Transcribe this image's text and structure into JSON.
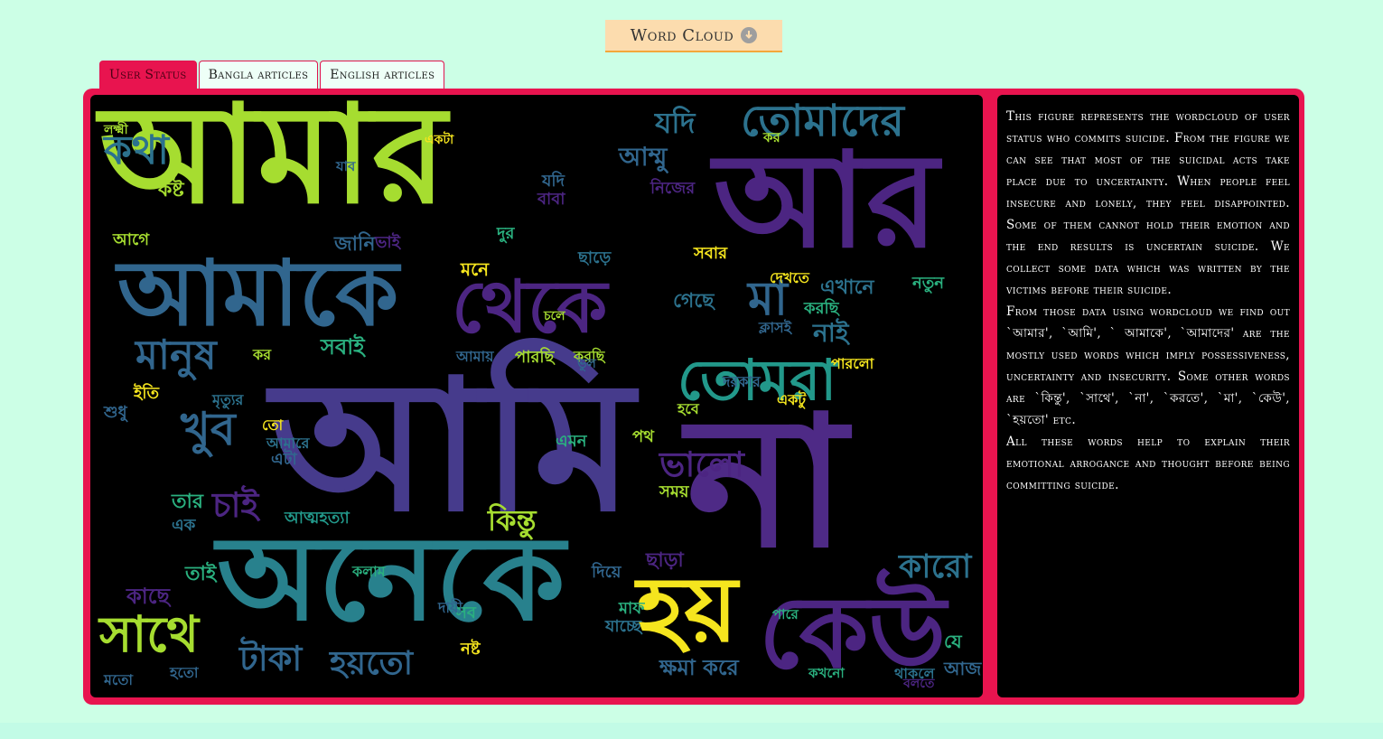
{
  "header_button": {
    "label": "Word Cloud",
    "icon": "download-circle-icon"
  },
  "tabs": [
    {
      "label": "User Status",
      "active": true
    },
    {
      "label": "Bangla articles",
      "active": false
    },
    {
      "label": "English articles",
      "active": false
    }
  ],
  "colors": {
    "page_bg": "#ccffe6",
    "accent": "#e8144f",
    "button_bg": "#fcdcae",
    "cloud_bg": "#000000"
  },
  "description": [
    "This figure represents the wordcloud of user status who commits suicide. From the figure we can see that most of the suicidal acts take place due to uncertainty. When people feel insecure and lonely, they feel disappointed. Some of them cannot hold their emotion and the end results is uncertain suicide. We collect some data which was written by the victims before their suicide.",
    "From those data using wordcloud we find out `আমার', `আমি', ` আমাকে', `আমাদের' are the mostly used words which imply possessiveness, uncertainty and insecurity. Some other words are `কিন্তু', `সাথে', `না', `করতে', `মা', `কেউ', `হয়তো' etc.",
    "All these words help to explain their emotional arrogance and thought before being committing suicide."
  ],
  "wordcloud": [
    {
      "text": "আমার",
      "color": "#a6dd30"
    },
    {
      "text": "আমি",
      "color": "#463b8c"
    },
    {
      "text": "আর",
      "color": "#4c2582"
    },
    {
      "text": "আমাকে",
      "color": "#31668e"
    },
    {
      "text": "অনেকে",
      "color": "#28818d"
    },
    {
      "text": "না",
      "color": "#4e2a86"
    },
    {
      "text": "থেকে",
      "color": "#4c2582"
    },
    {
      "text": "হয়",
      "color": "#f5e51e"
    },
    {
      "text": "কেউ",
      "color": "#4c2582"
    },
    {
      "text": "তোমাদের",
      "color": "#2c728e"
    },
    {
      "text": "তোমরা",
      "color": "#22988a"
    },
    {
      "text": "মানুষ",
      "color": "#31668e"
    },
    {
      "text": "সাথে",
      "color": "#a6dd30"
    },
    {
      "text": "খুব",
      "color": "#31668e"
    },
    {
      "text": "মা",
      "color": "#31668e"
    },
    {
      "text": "ভালো",
      "color": "#4c2582"
    },
    {
      "text": "কিন্তু",
      "color": "#a6dd30"
    },
    {
      "text": "যদি",
      "color": "#2c728e"
    },
    {
      "text": "আম্মু",
      "color": "#31668e"
    },
    {
      "text": "কষ্ট",
      "color": "#a6dd30"
    },
    {
      "text": "সবাই",
      "color": "#2ab07f"
    },
    {
      "text": "টাকা",
      "color": "#31668e"
    },
    {
      "text": "হয়তো",
      "color": "#31668e"
    },
    {
      "text": "চাই",
      "color": "#4c2582"
    },
    {
      "text": "তাই",
      "color": "#2ab07f"
    },
    {
      "text": "ক্ষমা করে",
      "color": "#31668e"
    },
    {
      "text": "এখানে",
      "color": "#2c728e"
    },
    {
      "text": "নাই",
      "color": "#2c728e"
    },
    {
      "text": "আত্মহত্যা",
      "color": "#22988a"
    },
    {
      "text": "জানি",
      "color": "#31668e"
    },
    {
      "text": "ছাড়া",
      "color": "#4c2582"
    },
    {
      "text": "কারো",
      "color": "#2c728e"
    },
    {
      "text": "নিজের",
      "color": "#4c2582"
    },
    {
      "text": "করছি",
      "color": "#2ab07f"
    },
    {
      "text": "কথা",
      "color": "#2c728e"
    },
    {
      "text": "যাব",
      "color": "#31668e"
    },
    {
      "text": "যদি",
      "color": "#31668e"
    },
    {
      "text": "বাবা",
      "color": "#4c2582"
    },
    {
      "text": "লক্ষ্মী",
      "color": "#a6dd30"
    },
    {
      "text": "আগে",
      "color": "#a6dd30"
    },
    {
      "text": "ভাই",
      "color": "#4c2582"
    },
    {
      "text": "মনে",
      "color": "#f5e51e"
    },
    {
      "text": "দুর",
      "color": "#2ab07f"
    },
    {
      "text": "ইতি",
      "color": "#f5e51e"
    },
    {
      "text": "শুধু",
      "color": "#31668e"
    },
    {
      "text": "সময়",
      "color": "#a6dd30"
    },
    {
      "text": "পথ",
      "color": "#a6dd30"
    },
    {
      "text": "এমন",
      "color": "#2ab07f"
    },
    {
      "text": "নতুন",
      "color": "#2ab07f"
    },
    {
      "text": "দিয়ে",
      "color": "#31668e"
    },
    {
      "text": "ছাড়ে",
      "color": "#2c728e"
    },
    {
      "text": "সবার",
      "color": "#f5e51e"
    },
    {
      "text": "গেছে",
      "color": "#2c728e"
    },
    {
      "text": "মাফ",
      "color": "#2ab07f"
    },
    {
      "text": "যাচ্ছে",
      "color": "#2c728e"
    },
    {
      "text": "কাছে",
      "color": "#4c2582"
    },
    {
      "text": "এক",
      "color": "#2c728e"
    },
    {
      "text": "তার",
      "color": "#2ab07f"
    },
    {
      "text": "সব",
      "color": "#2ab07f"
    },
    {
      "text": "নষ্ট",
      "color": "#f5e51e"
    },
    {
      "text": "আজ",
      "color": "#31668e"
    },
    {
      "text": "যে",
      "color": "#2ab07f"
    },
    {
      "text": "থাকলে",
      "color": "#2c728e"
    },
    {
      "text": "কখনো",
      "color": "#2ab07f"
    },
    {
      "text": "পারে",
      "color": "#2ab07f"
    },
    {
      "text": "বলতে",
      "color": "#4c2582"
    },
    {
      "text": "মতো",
      "color": "#31668e"
    },
    {
      "text": "হতো",
      "color": "#31668e"
    },
    {
      "text": "দরকার",
      "color": "#31668e"
    },
    {
      "text": "পারছি",
      "color": "#a6dd30"
    },
    {
      "text": "করছি",
      "color": "#a6dd30"
    },
    {
      "text": "আমায়",
      "color": "#31668e"
    },
    {
      "text": "মৃত্যুর",
      "color": "#2c728e"
    },
    {
      "text": "একটু",
      "color": "#f5e51e"
    },
    {
      "text": "হবে",
      "color": "#a6dd30"
    },
    {
      "text": "কলাম",
      "color": "#2ab07f"
    },
    {
      "text": "দেখতে",
      "color": "#f5e51e"
    },
    {
      "text": "ক্লাসই",
      "color": "#31668e"
    },
    {
      "text": "কর",
      "color": "#a6dd30"
    },
    {
      "text": "পারলো",
      "color": "#f5e51e"
    },
    {
      "text": "দায়ী",
      "color": "#31668e"
    },
    {
      "text": "কর",
      "color": "#a6dd30"
    },
    {
      "text": "তো",
      "color": "#f5e51e"
    },
    {
      "text": "আমারে",
      "color": "#2c728e"
    },
    {
      "text": "এটা",
      "color": "#31668e"
    },
    {
      "text": "একটা",
      "color": "#f5e51e"
    },
    {
      "text": "চলে",
      "color": "#a6dd30"
    },
    {
      "text": "ভুল",
      "color": "#31668e"
    }
  ]
}
